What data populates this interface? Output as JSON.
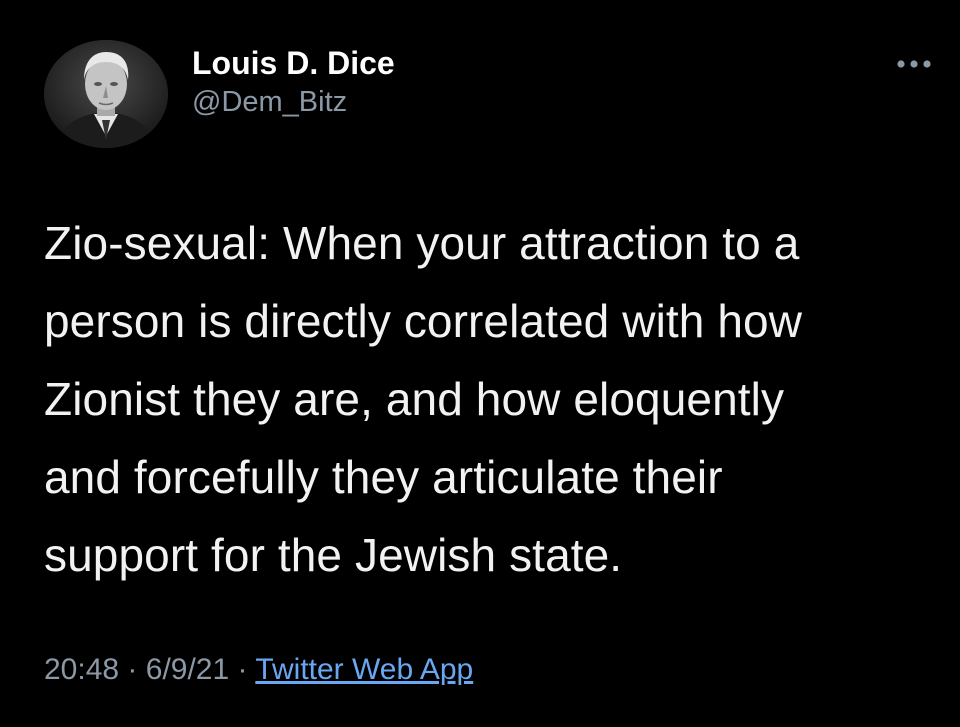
{
  "tweet": {
    "author": {
      "display_name": "Louis D. Dice",
      "handle": "@Dem_Bitz",
      "avatar_icon": "profile-photo-icon"
    },
    "more_icon": "ellipsis-icon",
    "text": "Zio-sexual: When your attraction to a\nperson is directly correlated with how\nZionist they are, and how eloquently\nand forcefully they articulate their\nsupport for the Jewish state.",
    "time": "20:48",
    "date": "6/9/21",
    "separator": "·",
    "source": "Twitter Web App"
  },
  "colors": {
    "background": "#000000",
    "primary_text": "#ffffff",
    "secondary_text": "#8b98a5",
    "link": "#6aa7f3"
  }
}
